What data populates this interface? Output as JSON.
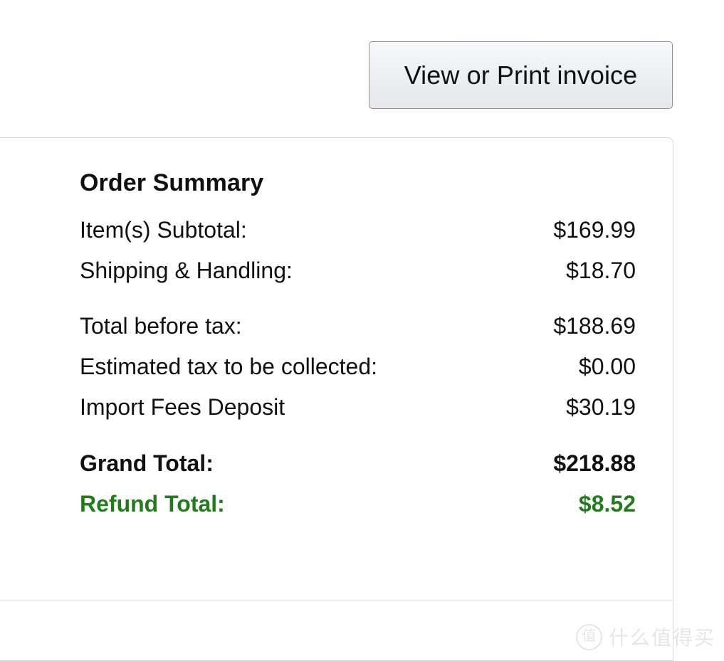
{
  "toolbar": {
    "invoice_button_label": "View or Print invoice"
  },
  "summary": {
    "title": "Order Summary",
    "rows": [
      {
        "label": "Item(s) Subtotal:",
        "value": "$169.99"
      },
      {
        "label": "Shipping & Handling:",
        "value": "$18.70"
      },
      {
        "label": "Total before tax:",
        "value": "$188.69"
      },
      {
        "label": "Estimated tax to be collected:",
        "value": "$0.00"
      },
      {
        "label": "Import Fees Deposit",
        "value": "$30.19"
      },
      {
        "label": "Grand Total:",
        "value": "$218.88"
      },
      {
        "label": "Refund Total:",
        "value": "$8.52"
      }
    ]
  },
  "watermark": {
    "badge": "值",
    "text": "什么值得买"
  },
  "colors": {
    "refund_green": "#237B1E",
    "text_primary": "#0f1111",
    "card_border": "#d5d9d9",
    "divider": "#dddddd",
    "button_border": "#8d9096",
    "watermark_gray": "#e6e6e6"
  }
}
